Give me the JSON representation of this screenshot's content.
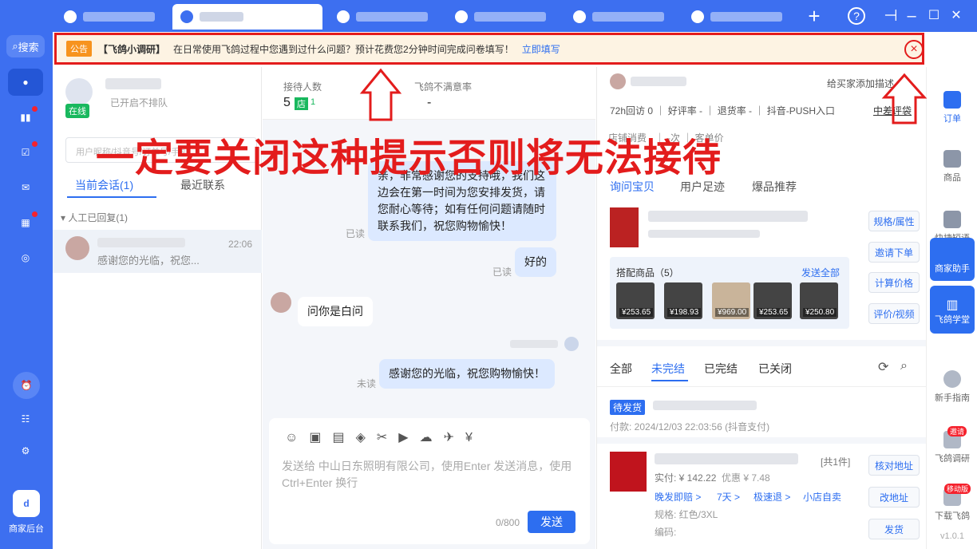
{
  "tabs": [
    {
      "label": ""
    },
    {
      "label": ""
    },
    {
      "label": ""
    },
    {
      "label": ""
    },
    {
      "label": ""
    },
    {
      "label": ""
    }
  ],
  "window": {
    "add": "+",
    "help": "?",
    "minimize": "–",
    "maximize": "☐",
    "close": "✕"
  },
  "sidebar": {
    "search_label": "搜索",
    "bottom_label": "商家后台"
  },
  "notice": {
    "tag": "公告",
    "title": "【飞鸽小调研】",
    "text": "在日常使用飞鸽过程中您遇到过什么问题？预计花费您2分钟时间完成问卷填写！",
    "link": "立即填写"
  },
  "annotation": {
    "text": "一定要关闭这种提示否则将无法接待"
  },
  "agent": {
    "status": "在线",
    "queue": "已开启不排队"
  },
  "stats": {
    "receive_label": "接待人数",
    "receive_value": "5",
    "store_tag": "店",
    "receive_count": "1",
    "dissatisfied_label": "飞鸽不满意率",
    "dissatisfied_value": "-"
  },
  "search": {
    "placeholder": "用户昵称/抖音号/订单号/手机"
  },
  "session_tabs": {
    "current": "当前会话(1)",
    "recent": "最近联系"
  },
  "group": {
    "label": "人工已回复(1)"
  },
  "session": {
    "time": "22:06",
    "preview": "感谢您的光临，祝您..."
  },
  "chat": {
    "msg1": "亲，非常感谢您的支持哦，我们这边会在第一时间为您安排发货，请您耐心等待；如有任何问题请随时联系我们，祝您购物愉快！",
    "read": "已读",
    "msg2": "好的",
    "msg3": "问你是白问",
    "msg4": "感谢您的光临，祝您购物愉快！",
    "unread": "未读",
    "input_placeholder": "发送给 中山日东照明有限公司，使用Enter 发送消息，使用Ctrl+Enter 换行",
    "counter": "0/800",
    "send": "发送"
  },
  "customer": {
    "note": "给买家添加描述",
    "stats": "72h回访 0 ｜ 好评率 - ｜ 退货率 - ｜ 抖音-PUSH入口",
    "middle": "中差评袋",
    "spending": "店铺消费 - ｜ -次 ｜ 客单价"
  },
  "product_tabs": {
    "t1": "询问宝贝",
    "t2": "用户足迹",
    "t3": "爆品推荐"
  },
  "product_buttons": {
    "b1": "规格/属性",
    "b2": "邀请下单",
    "b3": "计算价格",
    "b4": "评价/视频"
  },
  "combo": {
    "label": "搭配商品（5）",
    "send_all": "发送全部",
    "prices": [
      "¥253.65",
      "¥198.93",
      "¥969.00",
      "¥253.65",
      "¥250.80"
    ]
  },
  "order_tabs": {
    "all": "全部",
    "open": "未完结",
    "done": "已完结",
    "closed": "已关闭"
  },
  "order": {
    "status": "待发货",
    "paid": "付款: 2024/12/03 22:03:56 (抖音支付)",
    "count": "[共1件]",
    "actual": "实付: ¥ 142.22",
    "discount": "优惠 ¥ 7.48",
    "tag1": "晚发即赔 >",
    "tag2": "7天 >",
    "tag3": "极速退 >",
    "tag4": "小店自卖",
    "spec": "规格: 红色/3XL",
    "code": "编码:",
    "btn1": "核对地址",
    "btn2": "改地址",
    "btn3": "发货"
  },
  "rightbar": {
    "r1": "订单",
    "r2": "商品",
    "r3": "快捷短语",
    "r4": "商家助手",
    "r5": "飞鸽学堂",
    "r6": "新手指南",
    "r7": "飞鸽调研",
    "r8": "下载飞鸽",
    "badge7": "邀请",
    "badge8": "移动版",
    "version": "v1.0.1"
  }
}
